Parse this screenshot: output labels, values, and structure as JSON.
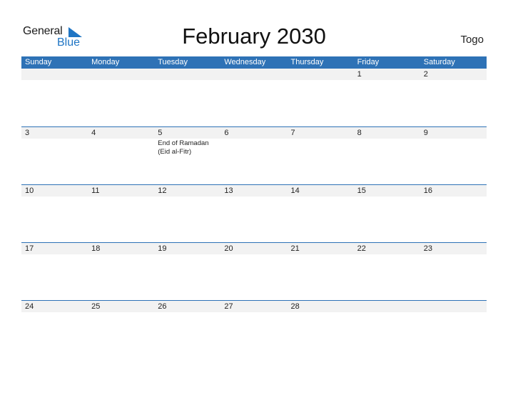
{
  "logo": {
    "general": "General",
    "blue": "Blue"
  },
  "title": "February 2030",
  "country": "Togo",
  "colors": {
    "accent": "#2e72b6",
    "strip": "#f2f2f2",
    "logo_blue": "#1f75c4"
  },
  "weekdays": [
    "Sunday",
    "Monday",
    "Tuesday",
    "Wednesday",
    "Thursday",
    "Friday",
    "Saturday"
  ],
  "weeks": [
    [
      {
        "day": ""
      },
      {
        "day": ""
      },
      {
        "day": ""
      },
      {
        "day": ""
      },
      {
        "day": ""
      },
      {
        "day": "1"
      },
      {
        "day": "2"
      }
    ],
    [
      {
        "day": "3"
      },
      {
        "day": "4"
      },
      {
        "day": "5",
        "event": "End of Ramadan (Eid al-Fitr)"
      },
      {
        "day": "6"
      },
      {
        "day": "7"
      },
      {
        "day": "8"
      },
      {
        "day": "9"
      }
    ],
    [
      {
        "day": "10"
      },
      {
        "day": "11"
      },
      {
        "day": "12"
      },
      {
        "day": "13"
      },
      {
        "day": "14"
      },
      {
        "day": "15"
      },
      {
        "day": "16"
      }
    ],
    [
      {
        "day": "17"
      },
      {
        "day": "18"
      },
      {
        "day": "19"
      },
      {
        "day": "20"
      },
      {
        "day": "21"
      },
      {
        "day": "22"
      },
      {
        "day": "23"
      }
    ],
    [
      {
        "day": "24"
      },
      {
        "day": "25"
      },
      {
        "day": "26"
      },
      {
        "day": "27"
      },
      {
        "day": "28"
      },
      {
        "day": ""
      },
      {
        "day": ""
      }
    ]
  ]
}
